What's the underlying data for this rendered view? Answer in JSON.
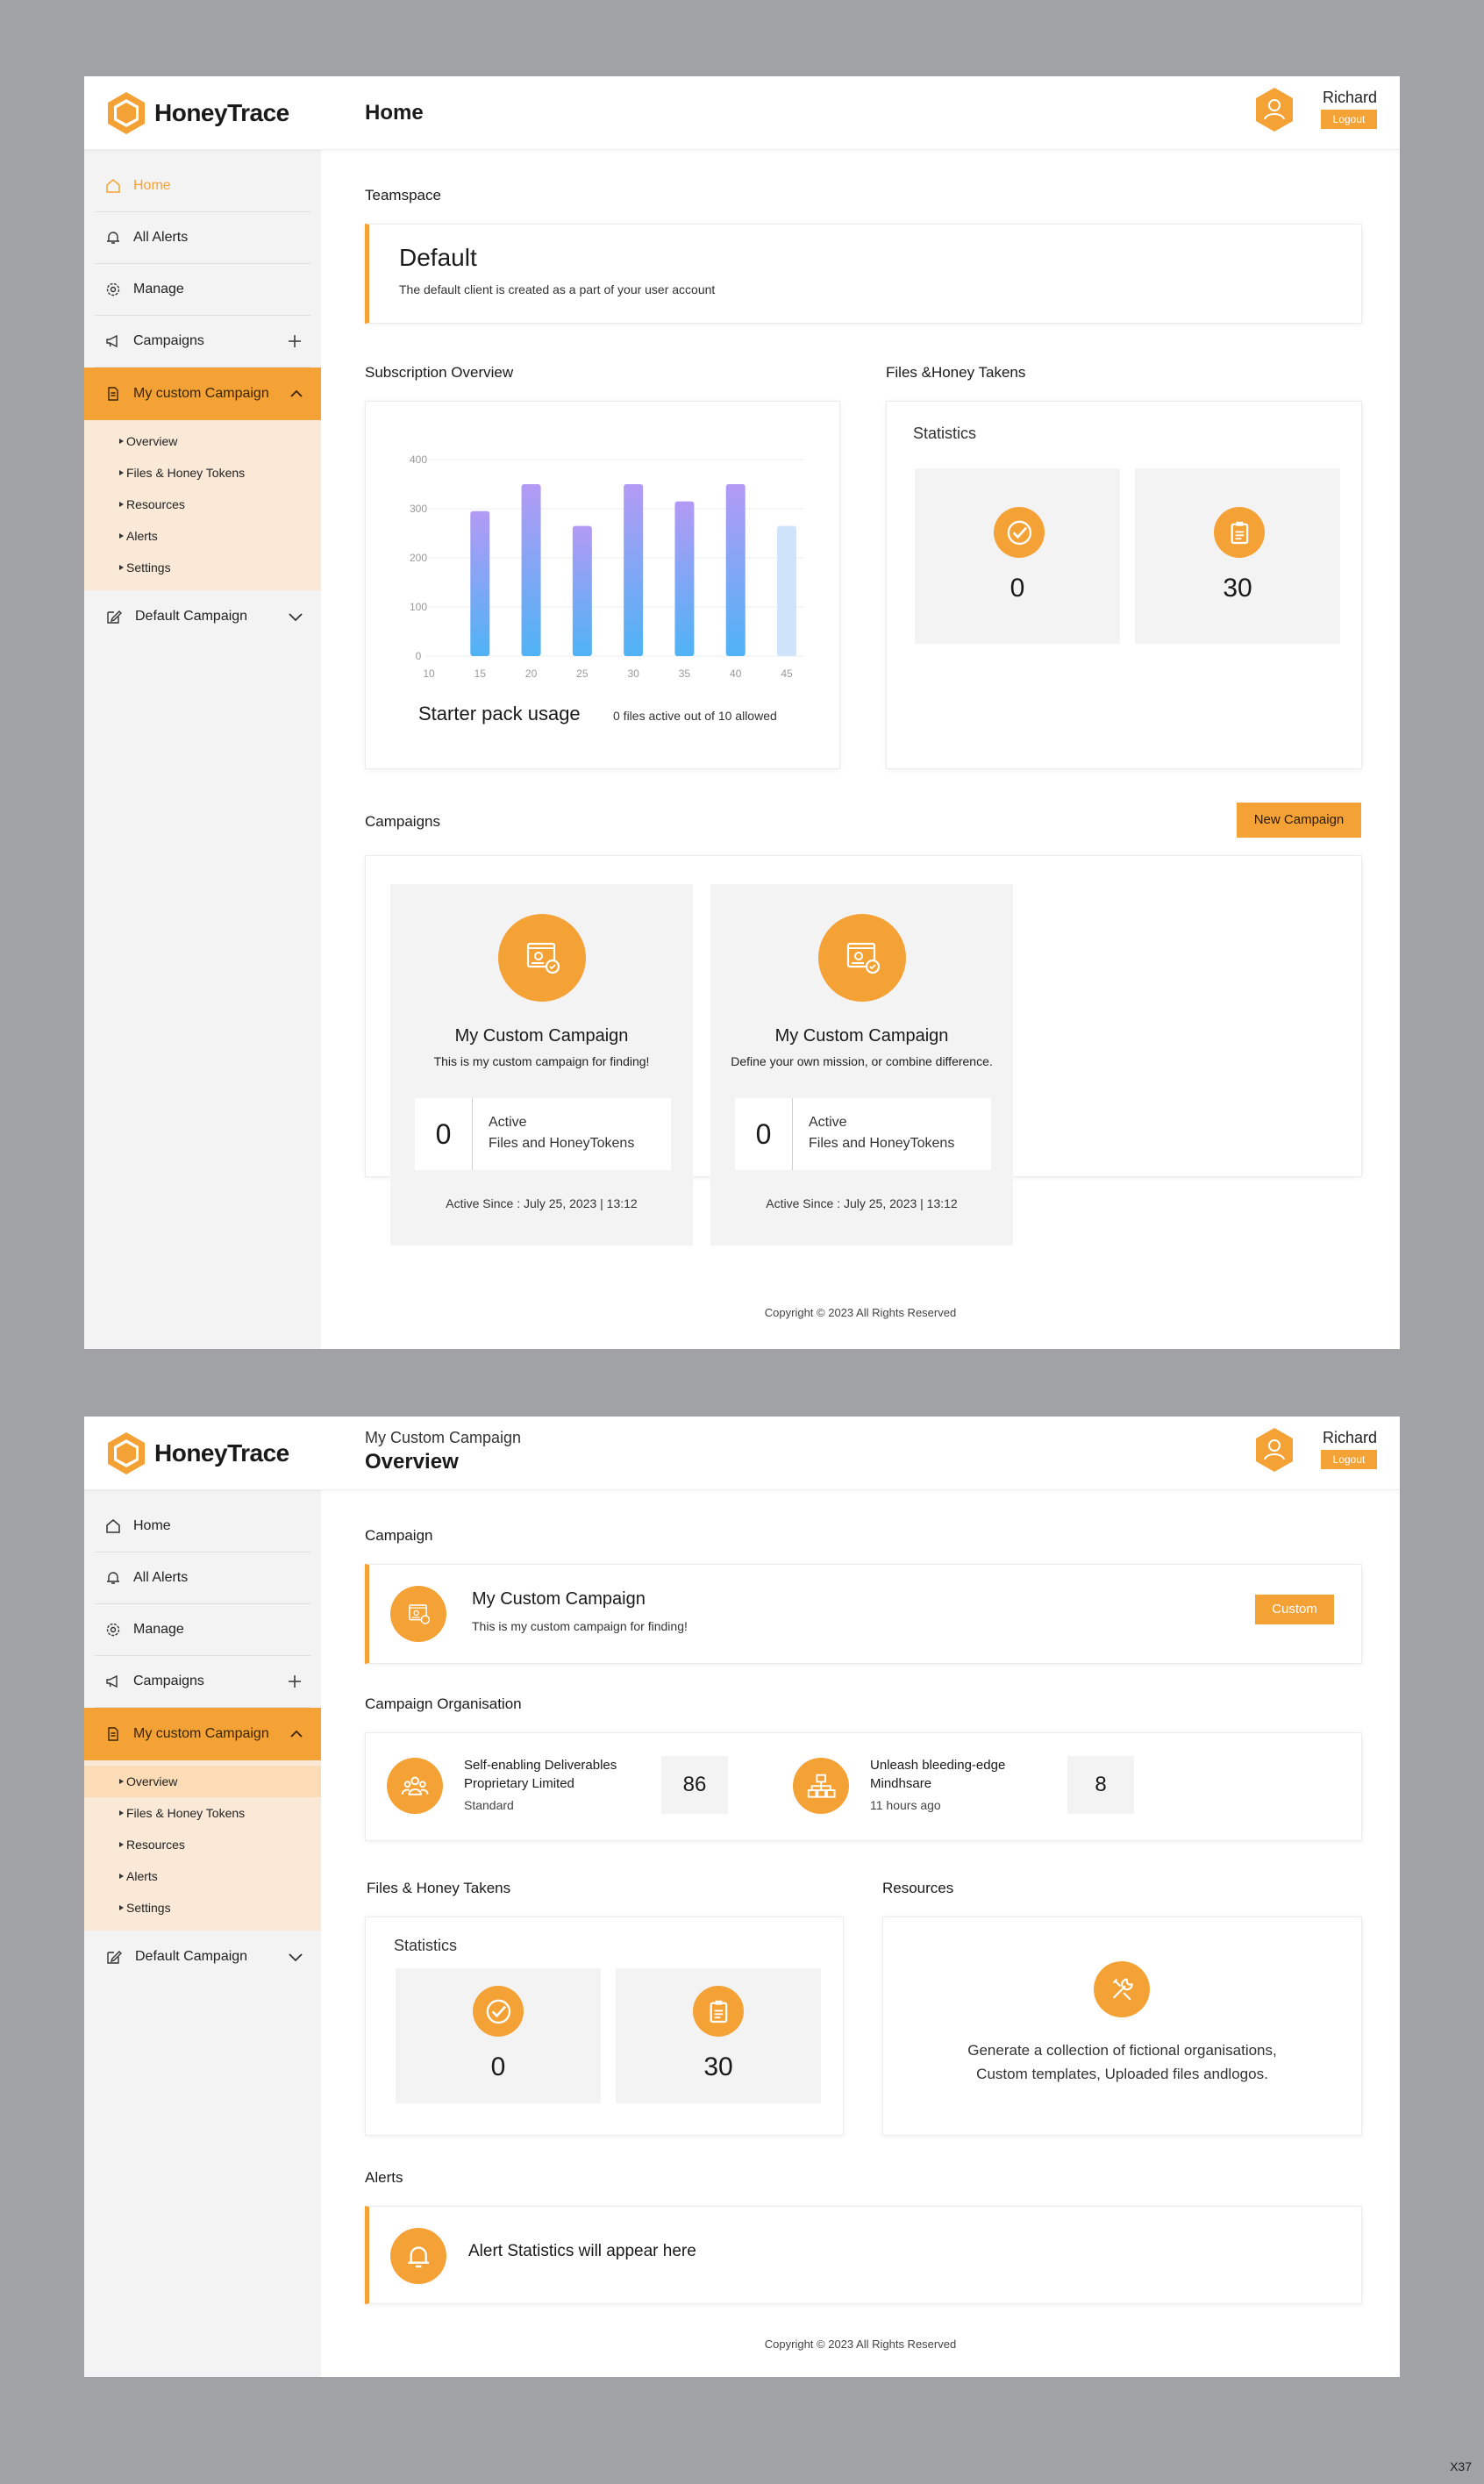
{
  "brand": {
    "name": "HoneyTrace",
    "accent": "#f4a236"
  },
  "user": {
    "name": "Richard",
    "logout_label": "Logout"
  },
  "sidebar": {
    "items": [
      {
        "label": "Home",
        "icon": "home-icon"
      },
      {
        "label": "All Alerts",
        "icon": "bell-icon"
      },
      {
        "label": "Manage",
        "icon": "gear-icon"
      },
      {
        "label": "Campaigns",
        "icon": "megaphone-icon"
      }
    ],
    "active_campaign": "My custom Campaign",
    "sub_items": [
      "Overview",
      "Files & Honey Tokens",
      "Resources",
      "Alerts",
      "Settings"
    ],
    "default_campaign": "Default Campaign"
  },
  "screen1": {
    "title": "Home",
    "teamspace": {
      "section": "Teamspace",
      "name": "Default",
      "description": "The default client is created as a part of your user account"
    },
    "subscription": {
      "section": "Subscription Overview",
      "usage_label": "Starter pack usage",
      "usage_text": "0 files active out of 10 allowed"
    },
    "files": {
      "section": "Files &Honey Takens",
      "stats_label": "Statistics",
      "active_count": "0",
      "total_count": "30"
    },
    "campaigns": {
      "section": "Campaigns",
      "new_button": "New Campaign",
      "cards": [
        {
          "title": "My Custom Campaign",
          "description": "This is my custom campaign for finding!",
          "count": "0",
          "count_label_1": "Active",
          "count_label_2": "Files and HoneyTokens",
          "since": "Active Since : July 25, 2023 | 13:12"
        },
        {
          "title": "My Custom Campaign",
          "description": "Define your own mission, or combine difference.",
          "count": "0",
          "count_label_1": "Active",
          "count_label_2": "Files and HoneyTokens",
          "since": "Active Since : July 25, 2023 | 13:12"
        }
      ]
    },
    "footer": "Copyright © 2023 All Rights Reserved"
  },
  "screen2": {
    "breadcrumb": "My Custom Campaign",
    "title": "Overview",
    "campaign": {
      "section": "Campaign",
      "name": "My Custom Campaign",
      "description": "This is my custom campaign for finding!",
      "type_button": "Custom"
    },
    "organisation": {
      "section": "Campaign Organisation",
      "items": [
        {
          "name_1": "Self-enabling Deliverables",
          "name_2": "Proprietary Limited",
          "meta": "Standard",
          "value": "86"
        },
        {
          "name_1": "Unleash bleeding-edge",
          "name_2": "Mindhsare",
          "meta": "11 hours ago",
          "value": "8"
        }
      ]
    },
    "files": {
      "section": "Files & Honey Takens",
      "stats_label": "Statistics",
      "active_count": "0",
      "total_count": "30"
    },
    "resources": {
      "section": "Resources",
      "text_1": "Generate a collection of fictional organisations,",
      "text_2": "Custom templates, Uploaded files andlogos."
    },
    "alerts": {
      "section": "Alerts",
      "text": "Alert Statistics will appear here"
    },
    "footer": "Copyright © 2023 All Rights Reserved"
  },
  "corner_label": "X37",
  "chart_data": {
    "type": "bar",
    "title": "",
    "xlabel": "",
    "ylabel": "",
    "x_ticks": [
      "10",
      "15",
      "20",
      "25",
      "30",
      "35",
      "40",
      "45"
    ],
    "y_ticks": [
      "0",
      "100",
      "200",
      "300",
      "400"
    ],
    "ylim": [
      0,
      400
    ],
    "categories": [
      "15",
      "20",
      "25",
      "30",
      "35",
      "40",
      "45"
    ],
    "values": [
      295,
      350,
      265,
      350,
      315,
      350,
      265
    ],
    "colors": {
      "bar_top": "#b39af5",
      "bar_bottom": "#4fb3f5",
      "last_bar": "#cfe3fb"
    },
    "grid": true
  }
}
